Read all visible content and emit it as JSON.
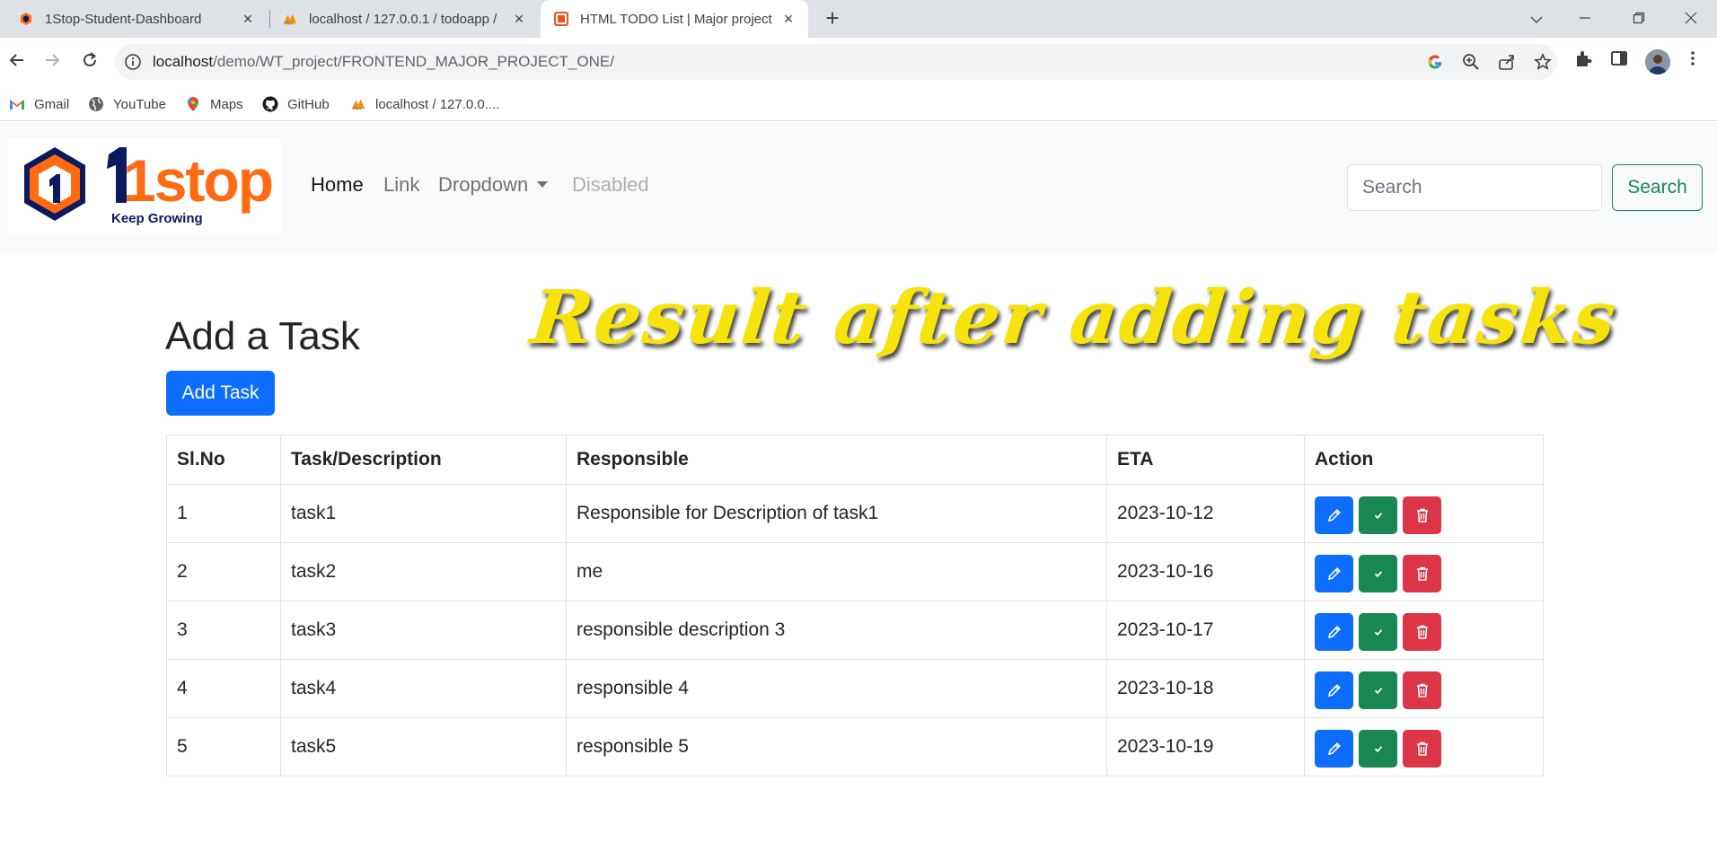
{
  "browser": {
    "tabs": [
      {
        "title": "1Stop-Student-Dashboard"
      },
      {
        "title": "localhost / 127.0.0.1 / todoapp /"
      },
      {
        "title": "HTML TODO List | Major project"
      }
    ],
    "url_host": "localhost",
    "url_path": "/demo/WT_project/FRONTEND_MAJOR_PROJECT_ONE/",
    "bookmarks": [
      "Gmail",
      "YouTube",
      "Maps",
      "GitHub",
      "localhost / 127.0.0...."
    ]
  },
  "navbar": {
    "logo": {
      "brand": "1stop",
      "tagline": "Keep Growing"
    },
    "links": [
      "Home",
      "Link",
      "Dropdown",
      "Disabled"
    ],
    "search_placeholder": "Search",
    "search_button": "Search"
  },
  "overlay_caption": "Result after adding tasks",
  "main": {
    "heading": "Add a Task",
    "add_button": "Add Task",
    "table": {
      "headers": [
        "Sl.No",
        "Task/Description",
        "Responsible",
        "ETA",
        "Action"
      ],
      "rows": [
        {
          "sl": "1",
          "task": "task1",
          "responsible": "Responsible for Description of task1",
          "eta": "2023-10-12"
        },
        {
          "sl": "2",
          "task": "task2",
          "responsible": "me",
          "eta": "2023-10-16"
        },
        {
          "sl": "3",
          "task": "task3",
          "responsible": "responsible description 3",
          "eta": "2023-10-17"
        },
        {
          "sl": "4",
          "task": "task4",
          "responsible": "responsible 4",
          "eta": "2023-10-18"
        },
        {
          "sl": "5",
          "task": "task5",
          "responsible": "responsible 5",
          "eta": "2023-10-19"
        }
      ]
    }
  },
  "colors": {
    "primary": "#0d6efd",
    "success": "#198754",
    "danger": "#dc3545",
    "caption": "#f5e30b",
    "logo_orange": "#ff6a13",
    "logo_navy": "#0a1a5c"
  }
}
